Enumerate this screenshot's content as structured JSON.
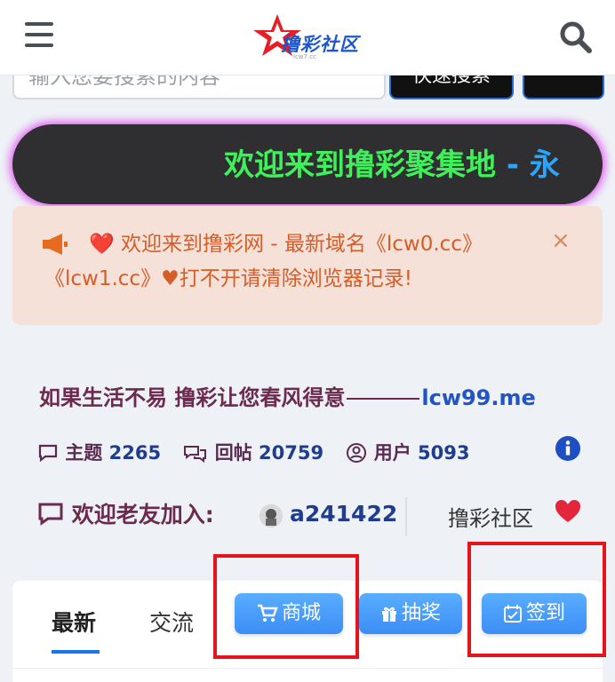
{
  "header": {
    "logo_text": "撸彩社区",
    "logo_subtext": "lcw7.cc",
    "menu_icon": "hamburger-menu-icon",
    "search_icon": "search-icon"
  },
  "search": {
    "placeholder": "输入您要搜索的内容",
    "button_label": "快速搜索"
  },
  "marquee": {
    "text_green": "欢迎来到撸彩聚集地",
    "text_blue": " - 永"
  },
  "notice": {
    "icon": "megaphone-icon",
    "text": "❤️ 欢迎来到撸彩网 - 最新域名《lcw0.cc》《lcw1.cc》♥打不开请清除浏览器记录!",
    "close_label": "×"
  },
  "slogan": {
    "text": "如果生活不易 撸彩让您春风得意",
    "domain": "lcw99.me"
  },
  "stats": {
    "topics_label": "主题",
    "topics_value": "2265",
    "replies_label": "回帖",
    "replies_value": "20759",
    "users_label": "用户",
    "users_value": "5093"
  },
  "welcome": {
    "label": "欢迎老友加入:",
    "username": "a241422",
    "community": "撸彩社区"
  },
  "tabs": {
    "latest": "最新",
    "exchange": "交流",
    "shop": "商城",
    "lottery": "抽奖",
    "checkin": "签到"
  },
  "colors": {
    "accent_blue": "#3c8df5",
    "highlight_red": "#e5141b",
    "marquee_green": "#3ff05a",
    "notice_bg": "#f6e1d8"
  }
}
